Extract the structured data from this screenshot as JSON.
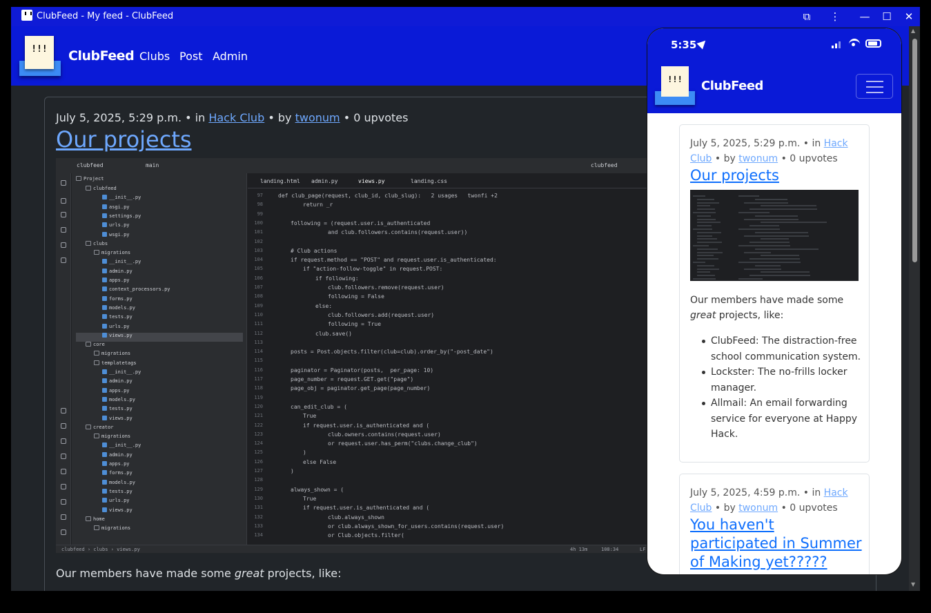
{
  "window": {
    "title": "ClubFeed - My feed - ClubFeed",
    "buttons": {
      "extension": "⧉",
      "menu": "⋮",
      "minimize": "—",
      "maximize": "☐",
      "close": "✕"
    }
  },
  "navbar": {
    "logo_text": "!!!",
    "brand": "ClubFeed",
    "links": [
      "Clubs",
      "Post",
      "Admin"
    ]
  },
  "post": {
    "date": "July 5, 2025, 5:29 p.m.",
    "in_label": "• in",
    "club": "Hack Club",
    "by_label": "• by",
    "author": "twonum",
    "upvotes": "• 0 upvotes",
    "title": "Our projects",
    "intro_before": "Our members have made some ",
    "intro_em": "great",
    "intro_after": " projects, like:"
  },
  "ide": {
    "project_label": "clubfeed",
    "branch_label": "main",
    "right_label": "clubfeed",
    "panel_title": "Project",
    "tree": [
      {
        "name": "clubfeed",
        "dir": true,
        "indent": 1
      },
      {
        "name": "__init__.py",
        "dir": false,
        "indent": 3
      },
      {
        "name": "asgi.py",
        "dir": false,
        "indent": 3
      },
      {
        "name": "settings.py",
        "dir": false,
        "indent": 3
      },
      {
        "name": "urls.py",
        "dir": false,
        "indent": 3
      },
      {
        "name": "wsgi.py",
        "dir": false,
        "indent": 3
      },
      {
        "name": "clubs",
        "dir": true,
        "indent": 1
      },
      {
        "name": "migrations",
        "dir": true,
        "indent": 2
      },
      {
        "name": "__init__.py",
        "dir": false,
        "indent": 3
      },
      {
        "name": "admin.py",
        "dir": false,
        "indent": 3
      },
      {
        "name": "apps.py",
        "dir": false,
        "indent": 3
      },
      {
        "name": "context_processors.py",
        "dir": false,
        "indent": 3
      },
      {
        "name": "forms.py",
        "dir": false,
        "indent": 3
      },
      {
        "name": "models.py",
        "dir": false,
        "indent": 3
      },
      {
        "name": "tests.py",
        "dir": false,
        "indent": 3
      },
      {
        "name": "urls.py",
        "dir": false,
        "indent": 3
      },
      {
        "name": "views.py",
        "dir": false,
        "indent": 3
      },
      {
        "name": "core",
        "dir": true,
        "indent": 1
      },
      {
        "name": "migrations",
        "dir": true,
        "indent": 2
      },
      {
        "name": "templatetags",
        "dir": true,
        "indent": 2
      },
      {
        "name": "__init__.py",
        "dir": false,
        "indent": 3
      },
      {
        "name": "admin.py",
        "dir": false,
        "indent": 3
      },
      {
        "name": "apps.py",
        "dir": false,
        "indent": 3
      },
      {
        "name": "models.py",
        "dir": false,
        "indent": 3
      },
      {
        "name": "tests.py",
        "dir": false,
        "indent": 3
      },
      {
        "name": "views.py",
        "dir": false,
        "indent": 3
      },
      {
        "name": "creator",
        "dir": true,
        "indent": 1
      },
      {
        "name": "migrations",
        "dir": true,
        "indent": 2
      },
      {
        "name": "__init__.py",
        "dir": false,
        "indent": 3
      },
      {
        "name": "admin.py",
        "dir": false,
        "indent": 3
      },
      {
        "name": "apps.py",
        "dir": false,
        "indent": 3
      },
      {
        "name": "forms.py",
        "dir": false,
        "indent": 3
      },
      {
        "name": "models.py",
        "dir": false,
        "indent": 3
      },
      {
        "name": "tests.py",
        "dir": false,
        "indent": 3
      },
      {
        "name": "urls.py",
        "dir": false,
        "indent": 3
      },
      {
        "name": "views.py",
        "dir": false,
        "indent": 3
      },
      {
        "name": "home",
        "dir": true,
        "indent": 1
      },
      {
        "name": "migrations",
        "dir": true,
        "indent": 2
      }
    ],
    "selected_file": "views.py",
    "tabs": [
      "landing.html",
      "admin.py",
      "views.py",
      "landing.css"
    ],
    "code": [
      {
        "n": "97",
        "i": 0,
        "t": "def club_page(request, club_id, club_slug):   2 usages   twonfi +2"
      },
      {
        "n": "98",
        "i": 2,
        "t": "return _r"
      },
      {
        "n": "99",
        "i": 0,
        "t": ""
      },
      {
        "n": "100",
        "i": 1,
        "t": "following = (request.user.is_authenticated"
      },
      {
        "n": "101",
        "i": 4,
        "t": "and club.followers.contains(request.user))"
      },
      {
        "n": "102",
        "i": 0,
        "t": ""
      },
      {
        "n": "103",
        "i": 1,
        "t": "# Club actions"
      },
      {
        "n": "104",
        "i": 1,
        "t": "if request.method == \"POST\" and request.user.is_authenticated:"
      },
      {
        "n": "105",
        "i": 2,
        "t": "if \"action-follow-toggle\" in request.POST:"
      },
      {
        "n": "106",
        "i": 3,
        "t": "if following:"
      },
      {
        "n": "107",
        "i": 4,
        "t": "club.followers.remove(request.user)"
      },
      {
        "n": "108",
        "i": 4,
        "t": "following = False"
      },
      {
        "n": "109",
        "i": 3,
        "t": "else:"
      },
      {
        "n": "110",
        "i": 4,
        "t": "club.followers.add(request.user)"
      },
      {
        "n": "111",
        "i": 4,
        "t": "following = True"
      },
      {
        "n": "112",
        "i": 3,
        "t": "club.save()"
      },
      {
        "n": "113",
        "i": 0,
        "t": ""
      },
      {
        "n": "114",
        "i": 1,
        "t": "posts = Post.objects.filter(club=club).order_by(\"-post_date\")"
      },
      {
        "n": "115",
        "i": 0,
        "t": ""
      },
      {
        "n": "116",
        "i": 1,
        "t": "paginator = Paginator(posts,  per_page: 10)"
      },
      {
        "n": "117",
        "i": 1,
        "t": "page_number = request.GET.get(\"page\")"
      },
      {
        "n": "118",
        "i": 1,
        "t": "page_obj = paginator.get_page(page_number)"
      },
      {
        "n": "119",
        "i": 0,
        "t": ""
      },
      {
        "n": "120",
        "i": 1,
        "t": "can_edit_club = ("
      },
      {
        "n": "121",
        "i": 2,
        "t": "True"
      },
      {
        "n": "122",
        "i": 2,
        "t": "if request.user.is_authenticated and ("
      },
      {
        "n": "123",
        "i": 4,
        "t": "club.owners.contains(request.user)"
      },
      {
        "n": "124",
        "i": 4,
        "t": "or request.user.has_perm(\"clubs.change_club\")"
      },
      {
        "n": "125",
        "i": 2,
        "t": ")"
      },
      {
        "n": "126",
        "i": 2,
        "t": "else False"
      },
      {
        "n": "127",
        "i": 1,
        "t": ")"
      },
      {
        "n": "128",
        "i": 0,
        "t": ""
      },
      {
        "n": "129",
        "i": 1,
        "t": "always_shown = ("
      },
      {
        "n": "130",
        "i": 2,
        "t": "True"
      },
      {
        "n": "131",
        "i": 2,
        "t": "if request.user.is_authenticated and ("
      },
      {
        "n": "132",
        "i": 4,
        "t": "club.always_shown"
      },
      {
        "n": "133",
        "i": 4,
        "t": "or club.always_shown_for_users.contains(request.user)"
      },
      {
        "n": "134",
        "i": 4,
        "t": "or Club.objects.filter("
      }
    ],
    "status_path": "clubfeed › clubs › views.py",
    "status_time": "4h 13m",
    "status_pos": "108:34",
    "status_lf": "LF"
  },
  "phone": {
    "time": "5:35",
    "logo_text": "!!!",
    "brand": "ClubFeed",
    "posts": [
      {
        "date": "July 5, 2025, 5:29 p.m.",
        "in_label": "• in",
        "club": "Hack Club",
        "by_label": "• by",
        "author": "twonum",
        "upvotes": "• 0 upvotes",
        "title": "Our projects",
        "intro_before": "Our members have made some ",
        "intro_em": "great",
        "intro_after": " projects, like:",
        "items": [
          "ClubFeed: The distraction-free school communication system.",
          "Lockster: The no-frills locker manager.",
          "Allmail: An email forwarding service for everyone at Happy Hack."
        ]
      },
      {
        "date": "July 5, 2025, 4:59 p.m.",
        "in_label": "• in",
        "club": "Hack Club",
        "by_label": "• by",
        "author": "twonum",
        "upvotes": "• 0 upvotes",
        "title": "You haven't participated in Summer of Making yet?????"
      }
    ]
  }
}
